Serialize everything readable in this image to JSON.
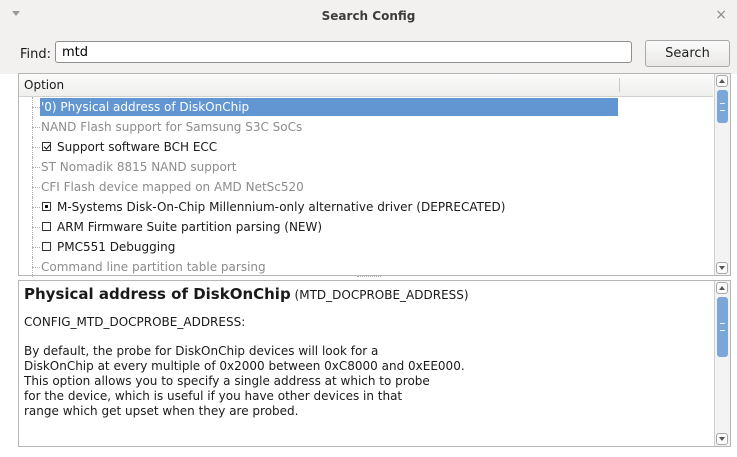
{
  "window": {
    "title": "Search Config",
    "close_glyph": "×"
  },
  "find": {
    "label": "Find:",
    "value": "mtd",
    "button_label": "Search"
  },
  "tree": {
    "column_header": "Option",
    "rows": [
      {
        "label": "'0) Physical address of DiskOnChip",
        "state": "selected",
        "checkbox": "none",
        "enabled": true
      },
      {
        "label": "NAND Flash support for Samsung S3C SoCs",
        "state": "normal",
        "checkbox": "none",
        "enabled": false
      },
      {
        "label": "Support software BCH ECC",
        "state": "normal",
        "checkbox": "checked",
        "enabled": true
      },
      {
        "label": "ST Nomadik 8815 NAND support",
        "state": "normal",
        "checkbox": "none",
        "enabled": false
      },
      {
        "label": "CFI Flash device mapped on AMD NetSc520",
        "state": "normal",
        "checkbox": "none",
        "enabled": false
      },
      {
        "label": "M-Systems Disk-On-Chip Millennium-only alternative driver (DEPRECATED)",
        "state": "normal",
        "checkbox": "module",
        "enabled": true
      },
      {
        "label": "ARM Firmware Suite partition parsing (NEW)",
        "state": "normal",
        "checkbox": "unchecked",
        "enabled": true
      },
      {
        "label": "PMC551 Debugging",
        "state": "normal",
        "checkbox": "unchecked",
        "enabled": true
      },
      {
        "label": "Command line partition table parsing",
        "state": "normal",
        "checkbox": "none",
        "enabled": false
      }
    ]
  },
  "info": {
    "title": "Physical address of DiskOnChip",
    "symbol": "(MTD_DOCPROBE_ADDRESS)",
    "config_name": "CONFIG_MTD_DOCPROBE_ADDRESS:",
    "description_lines": [
      "By default, the probe for DiskOnChip devices will look for a",
      "DiskOnChip at every multiple of 0x2000 between 0xC8000 and 0xEE000.",
      "This option allows you to specify a single address at which to probe",
      "for the device, which is useful if you have other devices in that",
      "range which get upset when they are probed."
    ]
  },
  "colors": {
    "selection": "#6196d3",
    "scroll_thumb": "#7aa6d8",
    "disabled_text": "#8c8c8c"
  }
}
